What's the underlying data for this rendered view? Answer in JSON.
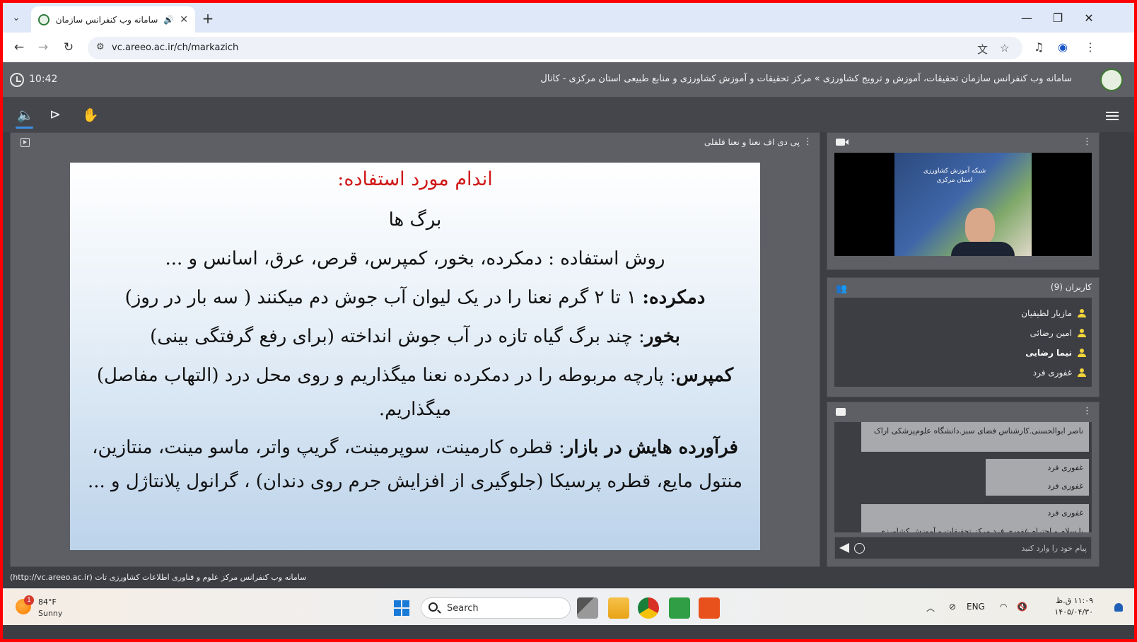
{
  "browser": {
    "tab_title": "سامانه وب کنفرانس سازمان تحقیقات",
    "url": "vc.areeo.ac.ir/ch/markazich",
    "icons": [
      "chevron-down-icon",
      "favicon",
      "speaker-icon",
      "close-icon",
      "plus-icon",
      "minimize-icon",
      "restore-icon",
      "close-window-icon",
      "back-icon",
      "forward-icon",
      "reload-icon",
      "site-info-icon",
      "translate-icon",
      "star-icon",
      "media-icon",
      "profile-icon",
      "more-icon"
    ]
  },
  "app": {
    "clock": "10:42",
    "title": "سامانه وب کنفرانس سازمان تحقیقات، آموزش و ترویج کشاورزی » مرکز تحقیقات و آموزش کشاورزی و منابع طبیعی استان مرکزی - کانال"
  },
  "presentation": {
    "title": "پی دی اف نعنا و نعنا فلفلی",
    "slide": {
      "heading": "اندام مورد استفاده:",
      "line1": "برگ ها",
      "line2": "روش استفاده : دمکرده، بخور، کمپرس، قرص، عرق، اسانس و ...",
      "line3_bold": "دمکرده:",
      "line3": " ۱ تا ۲ گرم نعنا را در یک لیوان آب جوش دم میکنند ( سه بار در روز)",
      "line4_bold": "بخور",
      "line4": ": چند برگ گیاه تازه در آب جوش انداخته (برای رفع گرفتگی بینی)",
      "line5_bold": "کمپرس",
      "line5": ": پارچه مربوطه را در دمکرده نعنا میگذاریم و روی محل درد (التهاب مفاصل)",
      "line6": "میگذاریم.",
      "line7_bold": "فرآورده هایش در بازار",
      "line7": ": قطره کارمینت، سوپرمینت، گریپ واتر، ماسو مینت، منتازین،",
      "line8": "منتول مایع، قطره پرسیکا (جلوگیری از افزایش جرم روی دندان) ، گرانول پلانتاژل و ..."
    }
  },
  "video": {
    "banner": "شبکه آموزش کشاورزی استان مرکزی"
  },
  "users": {
    "title": "کاربران (9)",
    "list": [
      "مازیار لطیفیان",
      "امین رضائی",
      "نیما رضایی",
      "غفوری فرد"
    ]
  },
  "chat": {
    "messages": [
      [
        "ناصر ابوالحسنی.کارشناس فضای سبز.دانشگاه علوم‌پزشکی اراک"
      ],
      [
        "غفوری فرد",
        "غفوری فرد"
      ],
      [
        "غفوری فرد",
        "با سلام و احترام غفوری فرد مرکز تحقیقات و آموزش کشاورزی"
      ]
    ],
    "placeholder": "پیام خود را وارد کنید"
  },
  "footer": {
    "text": "سامانه وب کنفرانس مرکز علوم و فناوری اطلاعات کشاورزی تات (http://vc.areeo.ac.ir)"
  },
  "taskbar": {
    "weather_badge": "1",
    "temperature": "84°F",
    "condition": "Sunny",
    "search": "Search",
    "lang": "ENG",
    "time": "۱۱:۰۹ ق.ظ",
    "date": "۱۴۰۵/۰۴/۳۰"
  }
}
